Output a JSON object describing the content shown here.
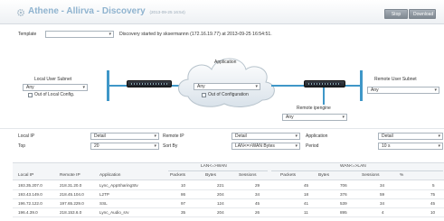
{
  "header": {
    "title": "Athene - Allirva - Discovery",
    "timestamp": "(2013-09-25 16:54)",
    "stop_label": "Stop",
    "download_label": "Download"
  },
  "template": {
    "label": "Template",
    "value": "",
    "info": "Discovery started by sksermannn (172.16.19.77) at 2013-09-25 16:54:51."
  },
  "topology": {
    "local_subnet_label": "Local User Subnet",
    "local_subnet_value": "Any",
    "local_out_of_config": "Out of Local Config.",
    "application_label": "Application",
    "application_value": "Any",
    "application_out_of_config": "Out of Configuration",
    "remote_subnet_label": "Remote User Subnet",
    "remote_subnet_value": "Any",
    "remote_engine_label": "Remote ipengine",
    "remote_engine_value": "Any"
  },
  "filters": {
    "local_ip_label": "Local IP",
    "local_ip_value": "Detail",
    "remote_ip_label": "Remote IP",
    "remote_ip_value": "Detail",
    "application_label": "Application",
    "application_value": "Detail",
    "top_label": "Top",
    "top_value": "20",
    "sort_by_label": "Sort By",
    "sort_by_value": "LAN<=>WAN Bytes",
    "period_label": "Period",
    "period_value": "10 s"
  },
  "table": {
    "group_lan_wan": "LAN<=>WAN",
    "group_wan_lan": "WAN<=>LAN",
    "columns": [
      "Local IP",
      "Remote IP",
      "Application",
      "Packets",
      "Bytes",
      "Sessions",
      "Packets",
      "Bytes",
      "Sessions",
      "%"
    ],
    "rows": [
      [
        "193.35.207.0",
        "218.31.20.0",
        "Lync_AppSharingStv",
        "10",
        "221",
        "29",
        "45",
        "706",
        "34",
        "5",
        ""
      ],
      [
        "193.43.149.0",
        "218.45.104.0",
        "L2TP",
        "86",
        "204",
        "34",
        "18",
        "376",
        "59",
        "75",
        ""
      ],
      [
        "196.72.122.0",
        "197.65.229.0",
        "SSL",
        "97",
        "124",
        "45",
        "41",
        "539",
        "34",
        "45",
        ""
      ],
      [
        "196.4.39.0",
        "218.153.6.0",
        "Lync_Audio_srv",
        "35",
        "204",
        "26",
        "11",
        "895",
        "4",
        "10",
        ""
      ]
    ]
  },
  "colors": {
    "title": "#8fb3cf",
    "accent_line": "#3f97c8",
    "button": "#8a939b"
  }
}
